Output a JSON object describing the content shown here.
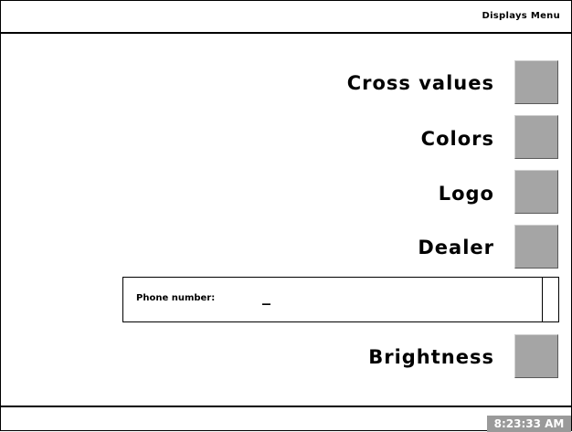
{
  "header": {
    "title": "Displays Menu"
  },
  "options": [
    {
      "label": "Cross values"
    },
    {
      "label": "Colors"
    },
    {
      "label": "Logo"
    },
    {
      "label": "Dealer"
    },
    {
      "label": "Brightness"
    }
  ],
  "phone_field": {
    "label": "Phone number:",
    "value": "_"
  },
  "footer": {
    "clock": "8:23:33 AM"
  },
  "colors": {
    "button_gray": "#a5a5a5",
    "clock_bg": "#9a9a9a",
    "clock_text": "#ffffff"
  }
}
